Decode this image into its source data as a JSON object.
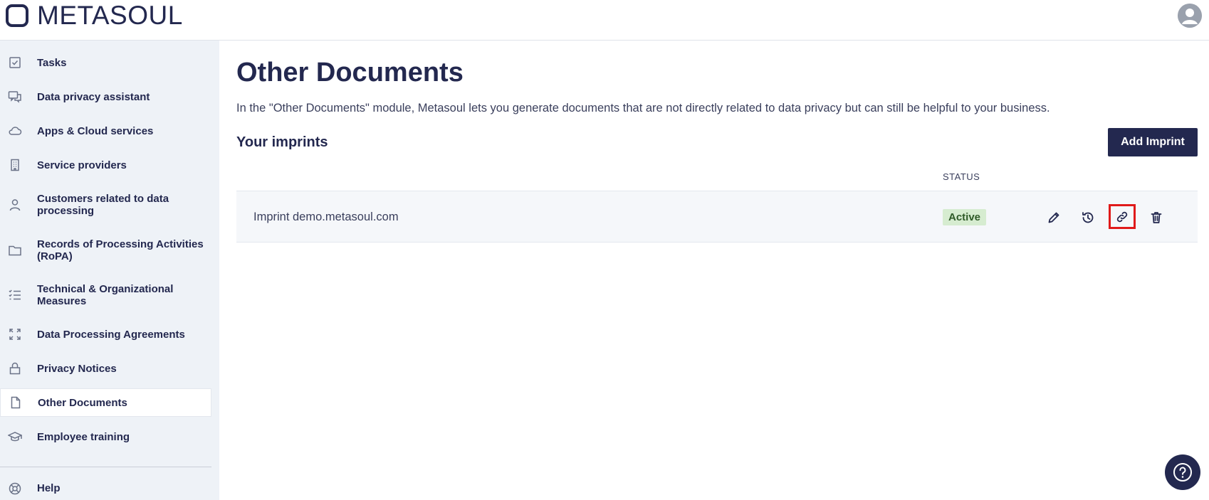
{
  "app": {
    "logo_text": "METASOUL"
  },
  "sidebar": {
    "items": [
      {
        "label": "Tasks",
        "icon": "checkbox-icon"
      },
      {
        "label": "Data privacy assistant",
        "icon": "chat-assistant-icon"
      },
      {
        "label": "Apps & Cloud services",
        "icon": "cloud-icon"
      },
      {
        "label": "Service providers",
        "icon": "building-icon"
      },
      {
        "label": "Customers related to data processing",
        "icon": "person-icon"
      },
      {
        "label": "Records of Processing Activities (RoPA)",
        "icon": "folder-icon"
      },
      {
        "label": "Technical & Organizational Measures",
        "icon": "checklist-icon"
      },
      {
        "label": "Data Processing Agreements",
        "icon": "arrows-icon"
      },
      {
        "label": "Privacy Notices",
        "icon": "lock-icon"
      },
      {
        "label": "Other Documents",
        "icon": "document-icon",
        "active": true
      },
      {
        "label": "Employee training",
        "icon": "graduation-cap-icon"
      }
    ],
    "help_label": "Help"
  },
  "main": {
    "title": "Other Documents",
    "description": "In the \"Other Documents\" module, Metasoul lets you generate documents that are not directly related to data privacy but can still be helpful to your business.",
    "section_title": "Your imprints",
    "add_button_label": "Add Imprint",
    "table": {
      "status_header": "STATUS",
      "rows": [
        {
          "name": "Imprint demo.metasoul.com",
          "status": "Active"
        }
      ]
    }
  },
  "colors": {
    "primary": "#23284f",
    "sidebar_bg": "#eef2f7",
    "badge_bg": "#d6ecd0",
    "badge_text": "#2f5a28",
    "highlight": "#e01a1a"
  }
}
